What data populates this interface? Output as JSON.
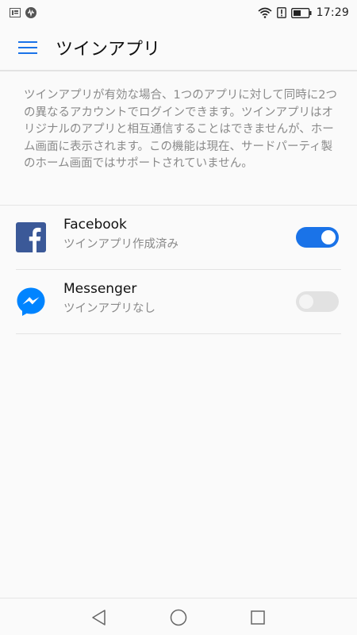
{
  "status_bar": {
    "time": "17:29",
    "left_icons": [
      "notification-icon",
      "audio-icon"
    ],
    "right_icons": [
      "wifi-icon",
      "alert-icon",
      "battery-icon"
    ]
  },
  "app_bar": {
    "title": "ツインアプリ",
    "menu_icon": "hamburger-menu-icon"
  },
  "description": "ツインアプリが有効な場合、1つのアプリに対して同時に2つの異なるアカウントでログインできます。ツインアプリはオリジナルのアプリと相互通信することはできませんが、ホーム画面に表示されます。この機能は現在、サードパーティ製のホーム画面ではサポートされていません。",
  "apps": [
    {
      "name": "Facebook",
      "status": "ツインアプリ作成済み",
      "icon": "facebook-icon",
      "enabled": true
    },
    {
      "name": "Messenger",
      "status": "ツインアプリなし",
      "icon": "messenger-icon",
      "enabled": false
    }
  ],
  "nav_bar": {
    "icons": [
      "back-triangle-icon",
      "home-circle-icon",
      "recents-square-icon"
    ]
  },
  "colors": {
    "accent": "#1a73e8",
    "toggle_off": "#e2e2e2",
    "facebook": "#3b5998",
    "messenger": "#0084ff"
  }
}
